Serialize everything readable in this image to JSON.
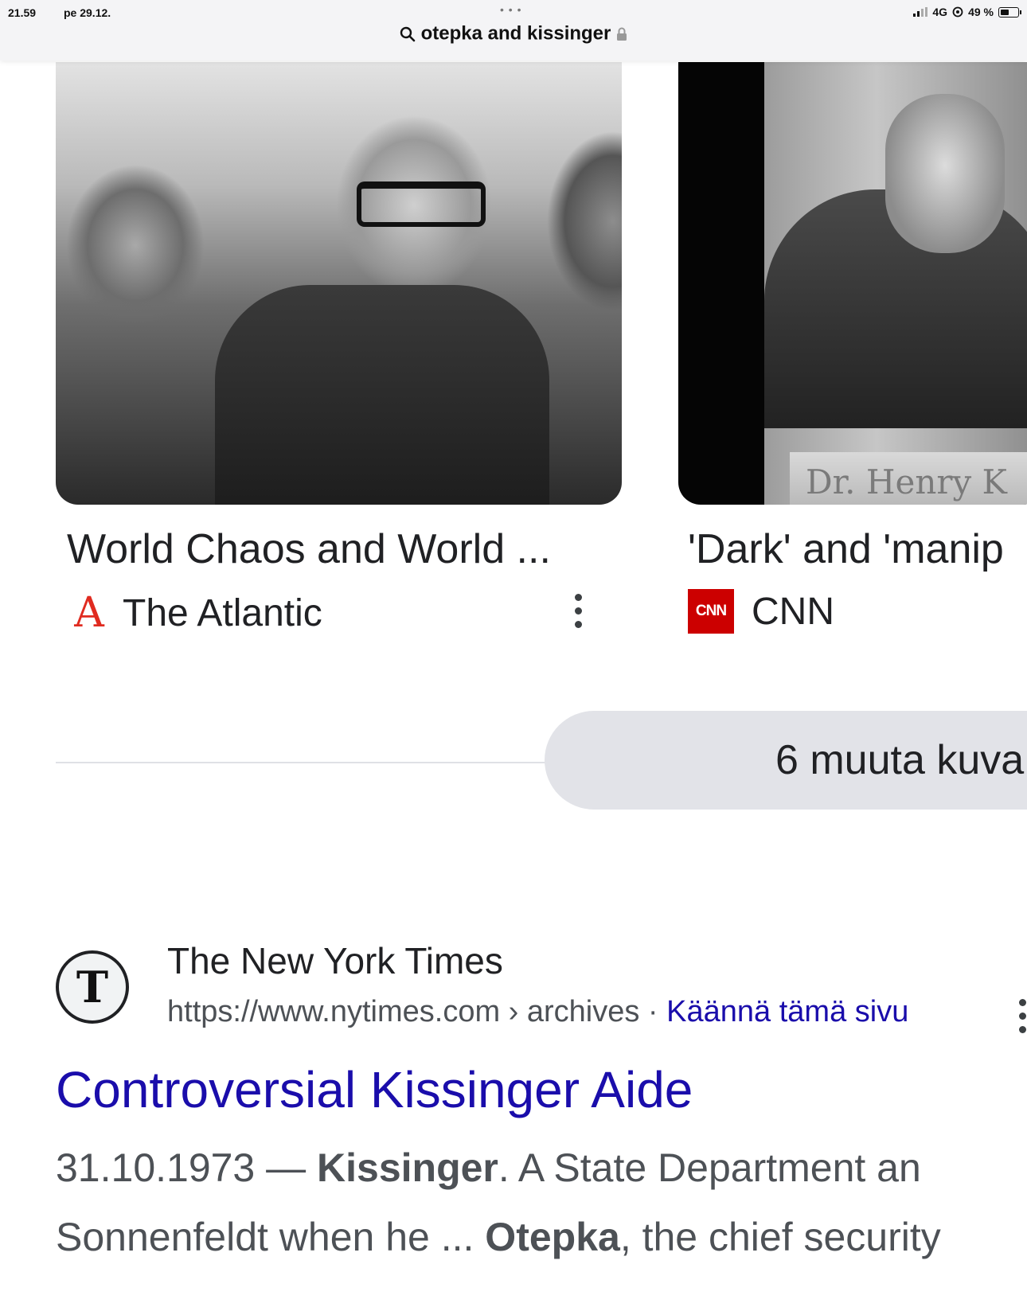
{
  "status_bar": {
    "time": "21.59",
    "date": "pe 29.12.",
    "network": "4G",
    "battery": "49 %",
    "dots": "• • •"
  },
  "address_bar": {
    "query": "otepka and kissinger",
    "search_icon": "search-icon",
    "lock_icon": "lock-icon"
  },
  "image_results": [
    {
      "title": "World Chaos and World ...",
      "source": "The Atlantic",
      "source_icon": "A",
      "icon_color": "#e02b20"
    },
    {
      "title": "'Dark' and 'manip",
      "source": "CNN",
      "source_icon": "CNN",
      "icon_color": "#cc0000",
      "nameplate": "Dr. Henry K"
    }
  ],
  "more_images_button": "6 muuta kuva",
  "result": {
    "site_name": "The New York Times",
    "logo_glyph": "T",
    "url": "https://www.nytimes.com › archives ·",
    "translate_link": "Käännä tämä sivu",
    "title": "Controversial Kissinger Aide",
    "snippet_line1": {
      "date": "31.10.1973 — ",
      "bold1": "Kissinger",
      "rest": ". A State Department an"
    },
    "snippet_line2": {
      "pre": "Sonnenfeldt when he ... ",
      "bold1": "Otepka",
      "rest": ", the chief security"
    }
  },
  "colors": {
    "link_blue": "#1a0dab",
    "pill_bg": "#e2e3e8",
    "status_bg": "#f4f4f6"
  }
}
